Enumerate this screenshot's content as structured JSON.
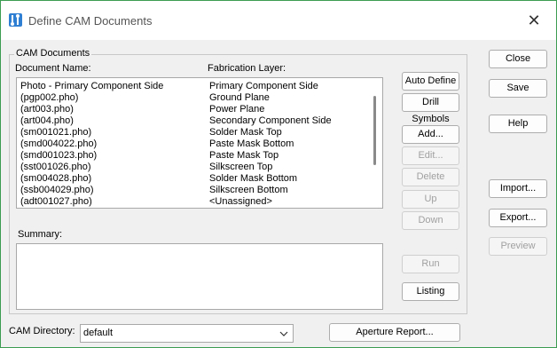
{
  "window": {
    "title": "Define CAM Documents",
    "close_glyph": "✕",
    "app_icon": "cam-app-icon"
  },
  "group": {
    "label": "CAM Documents"
  },
  "columns": {
    "document_name": "Document Name:",
    "fabrication_layer": "Fabrication Layer:"
  },
  "documents": [
    {
      "name": "Photo - Primary Component Side",
      "layer": "Primary Component Side"
    },
    {
      "name": "(pgp002.pho)",
      "layer": "Ground Plane"
    },
    {
      "name": "(art003.pho)",
      "layer": "Power Plane"
    },
    {
      "name": "(art004.pho)",
      "layer": "Secondary Component Side"
    },
    {
      "name": "(sm001021.pho)",
      "layer": "Solder Mask Top"
    },
    {
      "name": "(smd004022.pho)",
      "layer": "Paste Mask Bottom"
    },
    {
      "name": "(smd001023.pho)",
      "layer": "Paste Mask Top"
    },
    {
      "name": "(sst001026.pho)",
      "layer": "Silkscreen Top"
    },
    {
      "name": "(sm004028.pho)",
      "layer": "Solder Mask Bottom"
    },
    {
      "name": "(ssb004029.pho)",
      "layer": "Silkscreen Bottom"
    },
    {
      "name": "(adt001027.pho)",
      "layer": "<Unassigned>"
    }
  ],
  "summary": {
    "label": "Summary:",
    "value": ""
  },
  "buttons": {
    "auto_define": "Auto Define",
    "drill_symbols": "Drill Symbols",
    "add": "Add...",
    "edit": "Edit...",
    "delete": "Delete",
    "up": "Up",
    "down": "Down",
    "run": "Run",
    "listing": "Listing",
    "close": "Close",
    "save": "Save",
    "help": "Help",
    "import": "Import...",
    "export": "Export...",
    "preview": "Preview",
    "aperture_report": "Aperture Report..."
  },
  "cam_directory": {
    "label": "CAM Directory:",
    "value": "default"
  }
}
